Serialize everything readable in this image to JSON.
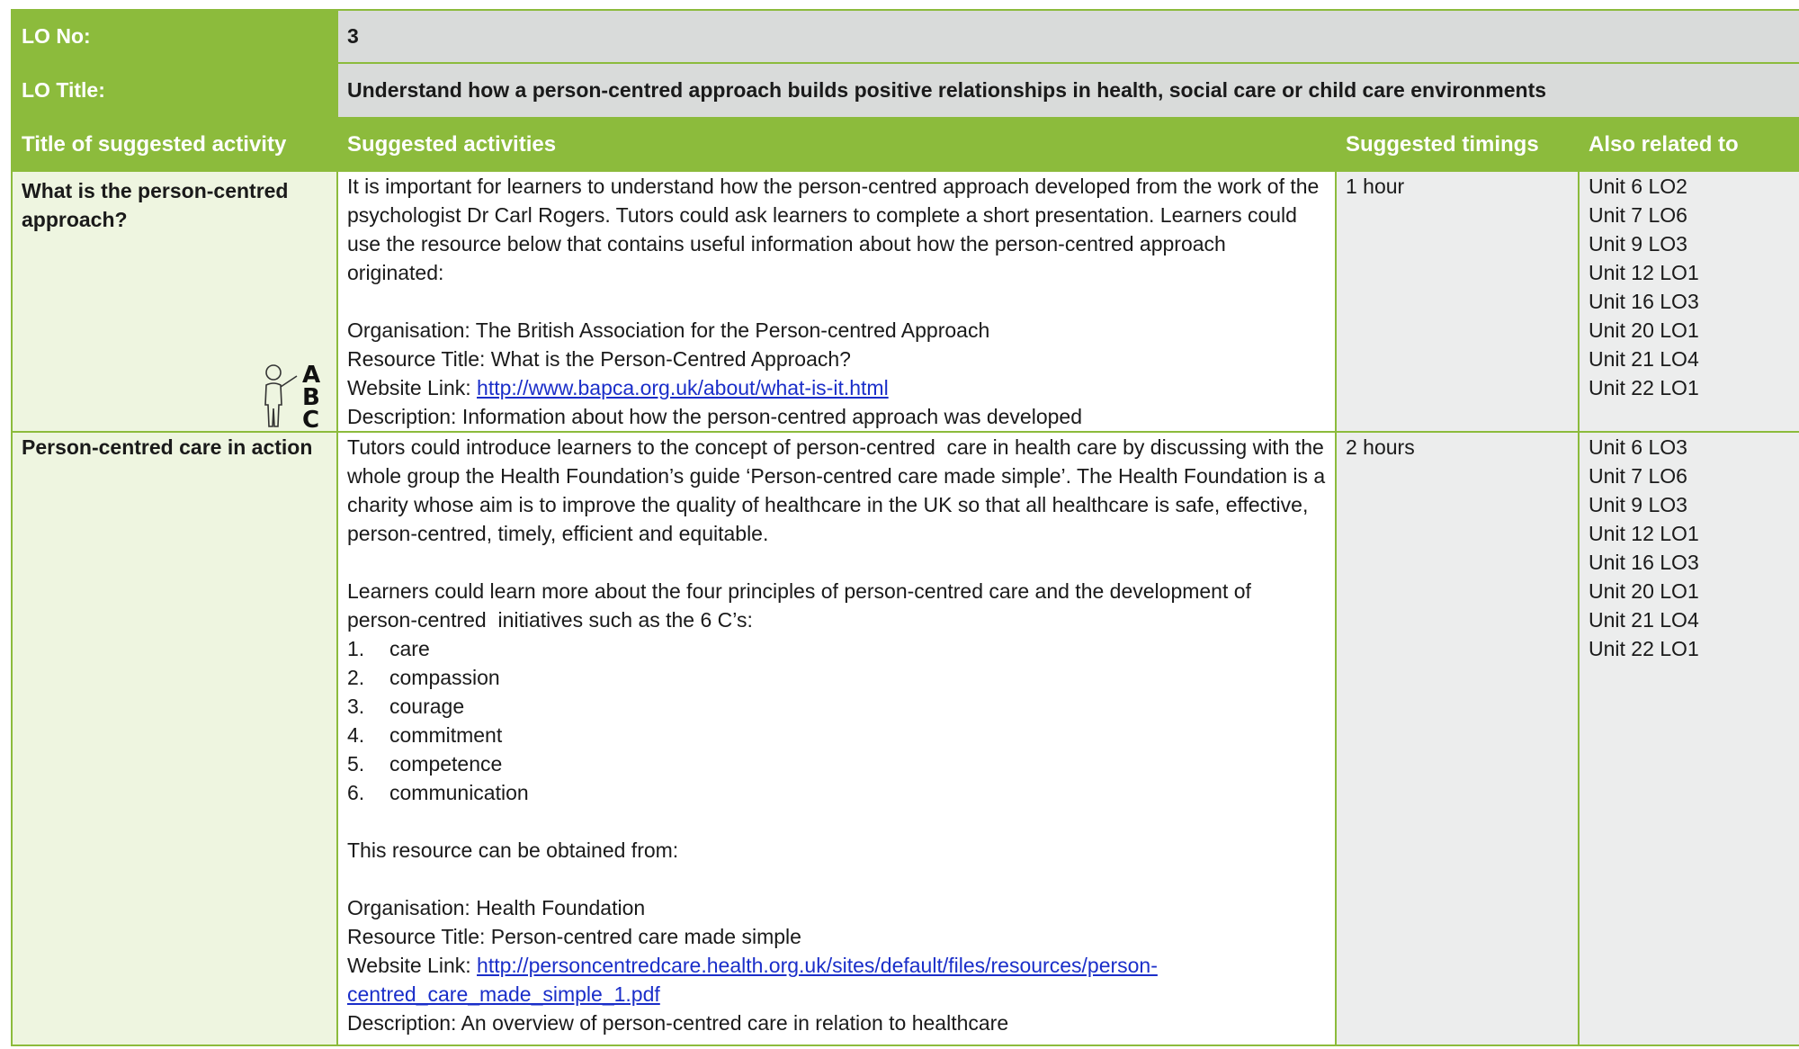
{
  "lo_no": {
    "label": "LO No:",
    "value": "3"
  },
  "lo_title": {
    "label": "LO Title:",
    "value": "Understand how a person-centred approach builds positive relationships in health, social care or child care environments"
  },
  "headers": {
    "title": "Title of suggested activity",
    "activities": "Suggested activities",
    "timings": "Suggested timings",
    "related": "Also related to"
  },
  "activities": [
    {
      "title": "What is the person-centred approach?",
      "icon": "abc-teacher-icon",
      "intro": "It is important for learners to understand how the person-centred approach developed from the work of the psychologist Dr Carl Rogers. Tutors could ask learners to complete a short presentation. Learners could use the resource below that contains useful information about how the person-centred approach originated:",
      "organisation": "Organisation: The British Association for the Person-centred Approach",
      "resource_title": "Resource Title: What is the Person-Centred Approach?",
      "website_label": "Website Link: ",
      "website_url": "http://www.bapca.org.uk/about/what-is-it.html",
      "description": "Description: Information about how the person-centred approach was developed",
      "timing": "1 hour",
      "related": [
        "Unit 6 LO2",
        "Unit 7 LO6",
        "Unit 9 LO3",
        "Unit 12 LO1",
        "Unit 16 LO3",
        "Unit 20 LO1",
        "Unit 21 LO4",
        "Unit 22 LO1"
      ]
    },
    {
      "title": "Person-centred care in action",
      "intro": "Tutors could introduce learners to the concept of person-centred  care in health care by discussing with the whole group the Health Foundation’s guide ‘Person-centred care made simple’. The Health Foundation is a charity whose aim is to improve the quality of healthcare in the UK so that all healthcare is safe, effective, person-centred, timely, efficient and equitable.",
      "para2": "Learners could learn more about the four principles of person-centred care and the development of person-centred  initiatives such as the 6 C’s:",
      "list": [
        {
          "num": "1.",
          "text": "care"
        },
        {
          "num": "2.",
          "text": "compassion"
        },
        {
          "num": "3.",
          "text": "courage"
        },
        {
          "num": "4.",
          "text": "commitment"
        },
        {
          "num": "5.",
          "text": "competence"
        },
        {
          "num": "6.",
          "text": "communication"
        }
      ],
      "para3": "This resource can be obtained from:",
      "organisation": "Organisation: Health Foundation",
      "resource_title": "Resource Title: Person-centred care made simple",
      "website_label": "Website Link: ",
      "website_url": "http://personcentredcare.health.org.uk/sites/default/files/resources/person-centred_care_made_simple_1.pdf",
      "description": "Description: An overview of person-centred care in relation to healthcare",
      "timing": "2 hours",
      "related": [
        "Unit 6 LO3",
        "Unit 7 LO6",
        "Unit 9 LO3",
        "Unit 12 LO1",
        "Unit 16 LO3",
        "Unit 20 LO1",
        "Unit 21 LO4",
        "Unit 22 LO1"
      ]
    }
  ]
}
